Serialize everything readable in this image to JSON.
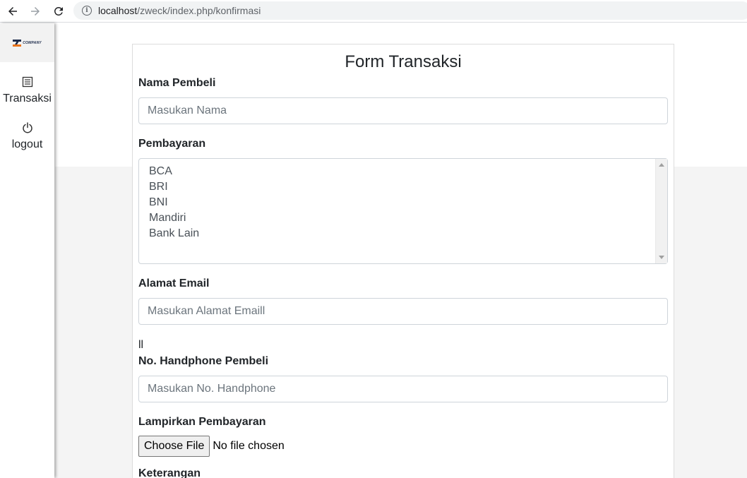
{
  "browser": {
    "url_host": "localhost",
    "url_path": "/zweck/index.php/konfirmasi"
  },
  "sidebar": {
    "logo_text": "COMPANY",
    "items": [
      {
        "label": "Transaksi",
        "icon": "list-icon"
      },
      {
        "label": "logout",
        "icon": "power-icon"
      }
    ]
  },
  "form": {
    "title": "Form Transaksi",
    "nama": {
      "label": "Nama Pembeli",
      "placeholder": "Masukan Nama"
    },
    "pembayaran": {
      "label": "Pembayaran",
      "options": [
        "BCA",
        "BRI",
        "BNI",
        "Mandiri",
        "Bank Lain"
      ]
    },
    "email": {
      "label": "Alamat Email",
      "placeholder": "Masukan Alamat Emaill"
    },
    "stray_text": "ll",
    "handphone": {
      "label": "No. Handphone Pembeli",
      "placeholder": "Masukan No. Handphone"
    },
    "lampiran": {
      "label": "Lampirkan Pembayaran",
      "button": "Choose File",
      "status": "No file chosen"
    },
    "keterangan": {
      "label": "Keterangan"
    }
  }
}
